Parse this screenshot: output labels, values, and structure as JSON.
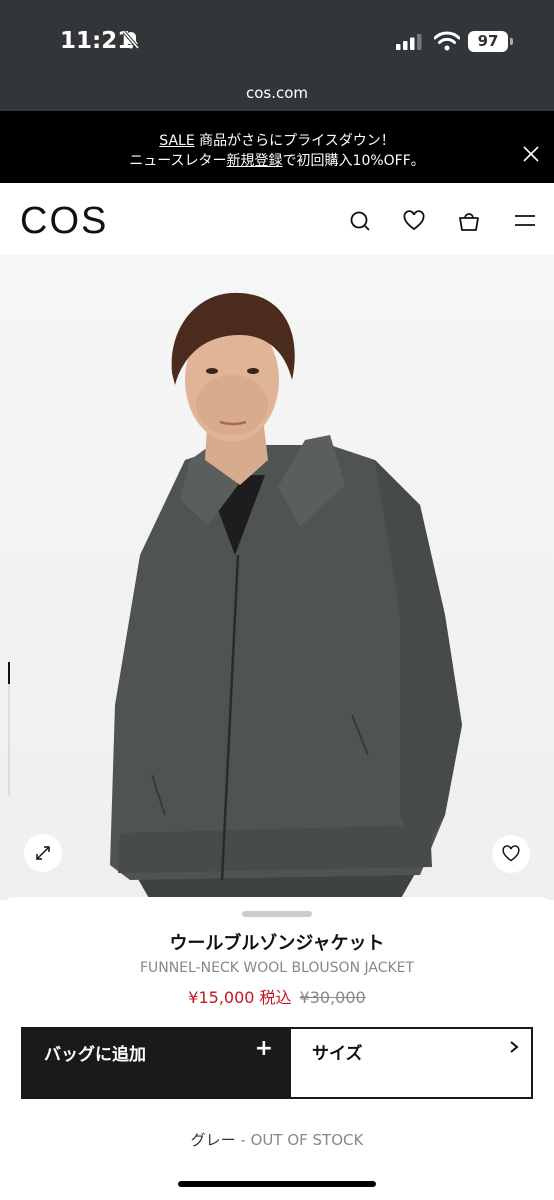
{
  "status_bar": {
    "time": "11:21",
    "battery": "97",
    "icons": [
      "bell-slash-icon",
      "signal-icon",
      "wifi-icon",
      "battery-icon"
    ]
  },
  "browser": {
    "url": "cos.com"
  },
  "promo": {
    "sale": "SALE",
    "text1": " 商品がさらにプライスダウン！",
    "text2a": "ニュースレター",
    "signup": "新規登録",
    "text2b": "で初回購入10%OFF。"
  },
  "header": {
    "logo": "COS",
    "icons": [
      "search-icon",
      "heart-icon",
      "bag-icon",
      "menu-icon"
    ]
  },
  "product": {
    "name_ja": "ウールブルゾンジャケット",
    "name_en": "FUNNEL-NECK WOOL BLOUSON JACKET",
    "price_sale": "¥15,000 税込",
    "price_original": "¥30,000",
    "color": "グレー",
    "stock_separator": " - ",
    "stock_status": "OUT OF STOCK"
  },
  "actions": {
    "add_to_bag": "バッグに追加",
    "add_symbol": "+",
    "size": "サイズ"
  },
  "colors": {
    "status_bar": "#333638",
    "promo_bg": "#000000",
    "sale_price": "#c4161c",
    "jacket": "#4f5452"
  }
}
